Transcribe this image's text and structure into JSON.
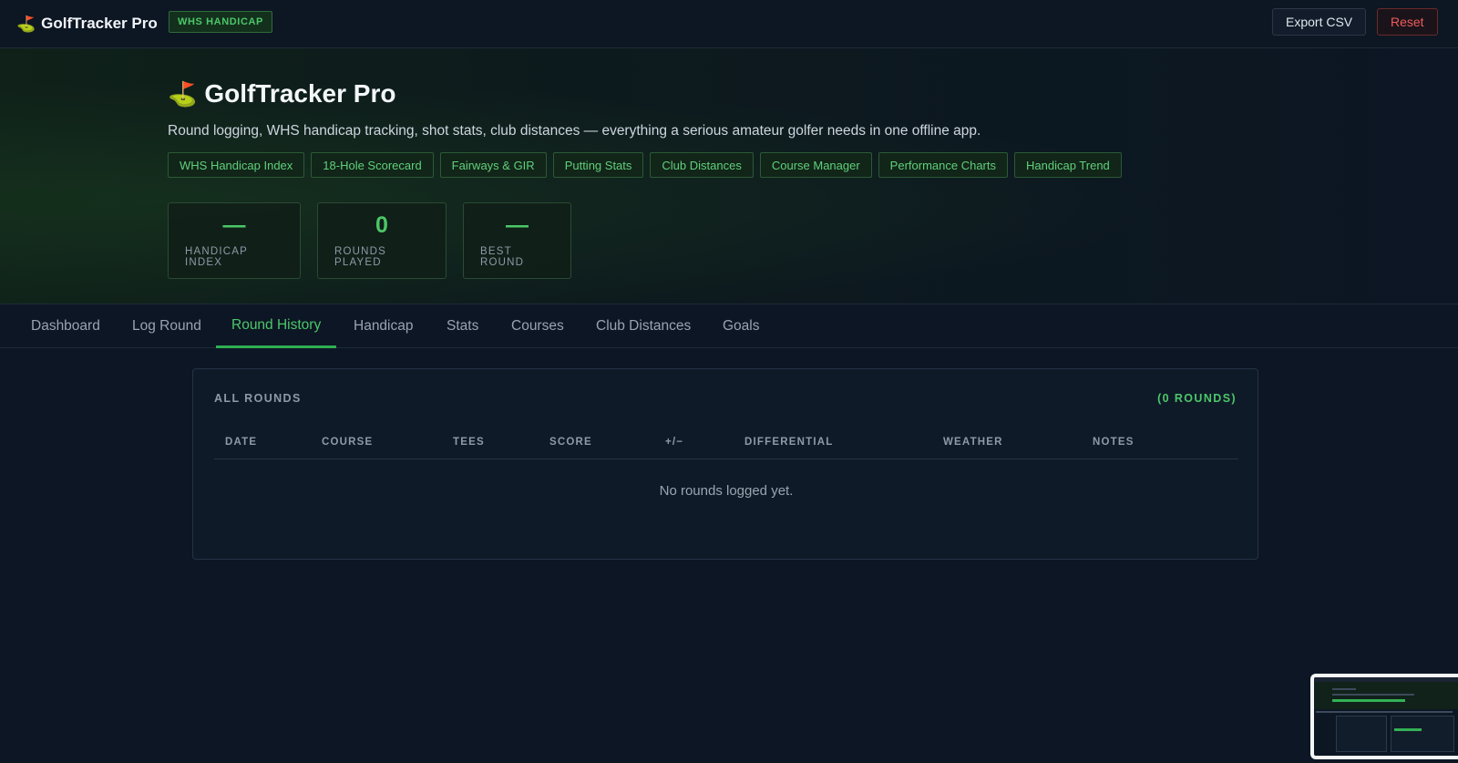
{
  "topbar": {
    "brand": "GolfTracker Pro",
    "badge": "WHS HANDICAP",
    "export_label": "Export CSV",
    "reset_label": "Reset"
  },
  "hero": {
    "title": "GolfTracker Pro",
    "subtitle": "Round logging, WHS handicap tracking, shot stats, club distances — everything a serious amateur golfer needs in one offline app.",
    "features": [
      "WHS Handicap Index",
      "18-Hole Scorecard",
      "Fairways & GIR",
      "Putting Stats",
      "Club Distances",
      "Course Manager",
      "Performance Charts",
      "Handicap Trend"
    ],
    "stats": [
      {
        "value": "—",
        "label": "HANDICAP INDEX"
      },
      {
        "value": "0",
        "label": "ROUNDS PLAYED"
      },
      {
        "value": "—",
        "label": "BEST ROUND"
      }
    ]
  },
  "tabs": [
    "Dashboard",
    "Log Round",
    "Round History",
    "Handicap",
    "Stats",
    "Courses",
    "Club Distances",
    "Goals"
  ],
  "active_tab": "Round History",
  "rounds": {
    "title": "ALL ROUNDS",
    "count": "(0 ROUNDS)",
    "columns": [
      "DATE",
      "COURSE",
      "TEES",
      "SCORE",
      "+/−",
      "DIFFERENTIAL",
      "WEATHER",
      "NOTES"
    ],
    "empty": "No rounds logged yet."
  },
  "colors": {
    "accent": "#4cc768",
    "danger": "#f05a5a",
    "background": "#0c1624"
  },
  "icons": {
    "flag": "golf-flag-icon"
  }
}
